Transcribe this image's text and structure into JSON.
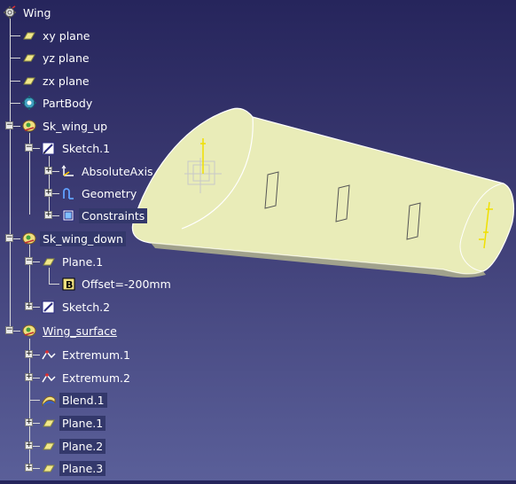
{
  "tree": {
    "root": "Wing",
    "planes": [
      "xy plane",
      "yz plane",
      "zx plane"
    ],
    "partbody": "PartBody",
    "sk_wing_up": {
      "label": "Sk_wing_up",
      "sketch": "Sketch.1",
      "children": [
        "AbsoluteAxis",
        "Geometry",
        "Constraints"
      ]
    },
    "sk_wing_down": {
      "label": "Sk_wing_down",
      "plane": "Plane.1",
      "offset": "Offset=-200mm",
      "sketch": "Sketch.2"
    },
    "wing_surface": {
      "label": "Wing_surface",
      "children": [
        "Extremum.1",
        "Extremum.2",
        "Blend.1",
        "Plane.1",
        "Plane.2",
        "Plane.3"
      ]
    }
  },
  "colors": {
    "surface_fill": "#e9ecb8",
    "background_top": "#26255c",
    "background_bottom": "#5a5f99",
    "plane_icon": "#f2e88a",
    "axis_yellow": "#f0e000"
  }
}
